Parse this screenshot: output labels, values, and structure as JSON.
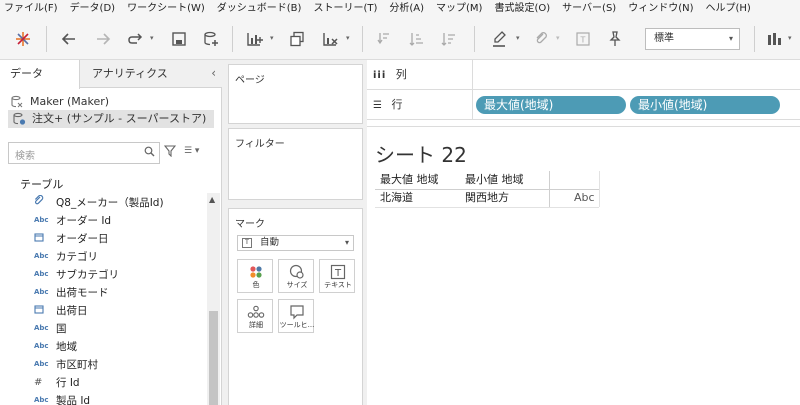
{
  "menu": [
    "ファイル(F)",
    "データ(D)",
    "ワークシート(W)",
    "ダッシュボード(B)",
    "ストーリー(T)",
    "分析(A)",
    "マップ(M)",
    "書式設定(O)",
    "サーバー(S)",
    "ウィンドウ(N)",
    "ヘルプ(H)"
  ],
  "toolbar": {
    "format_select": "標準"
  },
  "data_pane": {
    "tabs": [
      "データ",
      "アナリティクス"
    ],
    "datasources": [
      "Maker (Maker)",
      "注文+ (サンプル - スーパーストア)"
    ],
    "search_placeholder": "検索",
    "table_heading": "テーブル",
    "fields": [
      {
        "type": "link",
        "name": "Q8_メーカー（製品Id)"
      },
      {
        "type": "Abc",
        "name": "オーダー Id"
      },
      {
        "type": "date",
        "name": "オーダー日"
      },
      {
        "type": "Abc",
        "name": "カテゴリ"
      },
      {
        "type": "Abc",
        "name": "サブカテゴリ"
      },
      {
        "type": "Abc",
        "name": "出荷モード"
      },
      {
        "type": "date",
        "name": "出荷日"
      },
      {
        "type": "Abc",
        "name": "国"
      },
      {
        "type": "Abc",
        "name": "地域"
      },
      {
        "type": "Abc",
        "name": "市区町村"
      },
      {
        "type": "#",
        "name": "行 Id"
      },
      {
        "type": "Abc",
        "name": "製品 Id"
      }
    ]
  },
  "cards": {
    "pages": "ページ",
    "filters": "フィルター",
    "marks": "マーク",
    "marks_type": "自動",
    "mark_buttons": [
      "色",
      "サイズ",
      "テキスト",
      "詳細",
      "ツールヒ..."
    ]
  },
  "shelves": {
    "columns_label": "列",
    "rows_label": "行",
    "row_pills": [
      "最大値(地域)",
      "最小値(地域)"
    ]
  },
  "sheet": {
    "title": "シート 22",
    "headers": [
      "最大値 地域",
      "最小値 地域"
    ],
    "row": [
      "北海道",
      "関西地方",
      "Abc"
    ]
  }
}
